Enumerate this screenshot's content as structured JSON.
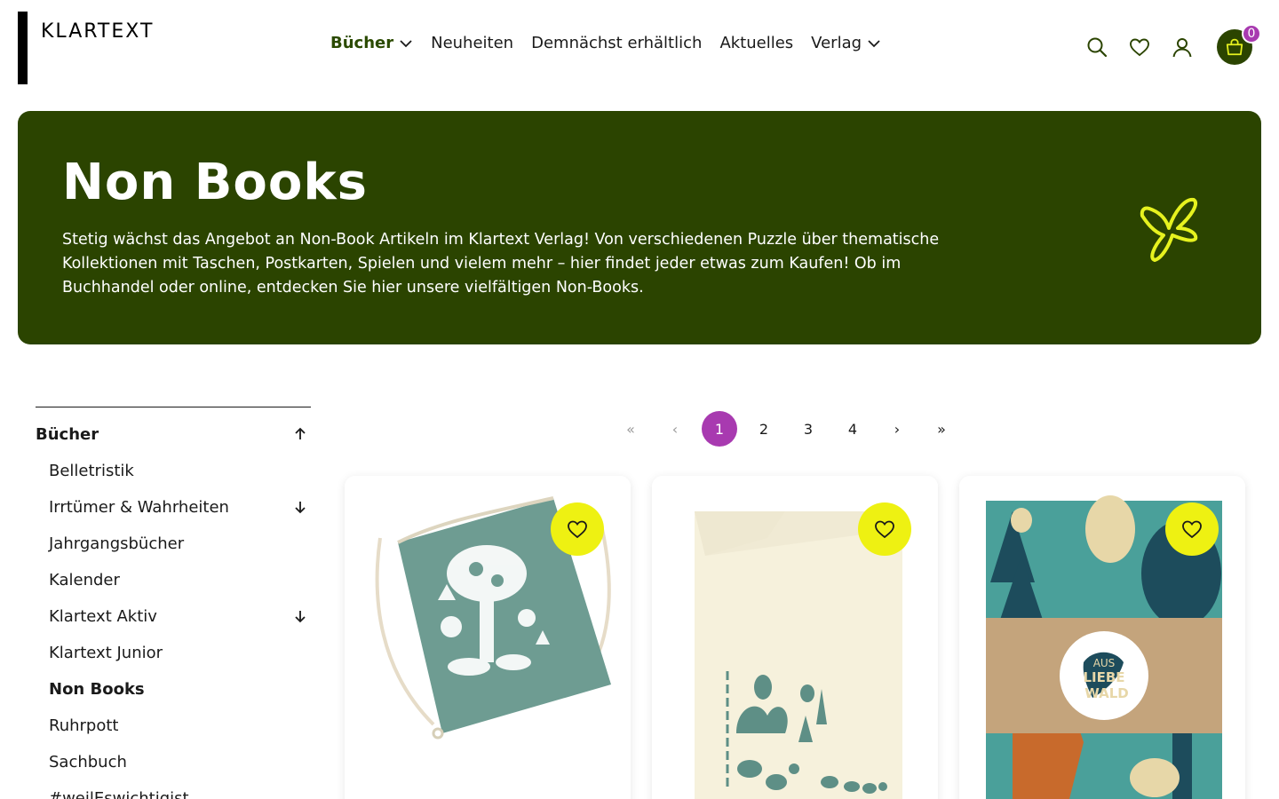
{
  "header": {
    "logo": "KLARTEXT",
    "nav": [
      {
        "label": "Bücher",
        "dropdown": true,
        "active": true
      },
      {
        "label": "Neuheiten"
      },
      {
        "label": "Demnächst erhältlich"
      },
      {
        "label": "Aktuelles"
      },
      {
        "label": "Verlag",
        "dropdown": true
      }
    ],
    "icons": [
      "search-icon",
      "heart-icon",
      "user-icon",
      "cart-icon"
    ],
    "cart_count": "0"
  },
  "hero": {
    "title": "Non Books",
    "text": "Stetig wächst das Angebot an Non-Book Artikeln im Klartext Verlag! Von verschiedenen Puzzle über thematische Kollektionen mit Taschen, Postkarten, Spielen und vielem mehr – hier findet jeder etwas zum Kaufen! Ob im Buchhandel oder online, entdecken Sie hier unsere vielfältigen Non-Books.",
    "background": "#2b4400",
    "accent": "#e6f21f"
  },
  "sidebar": {
    "heading": "Bücher",
    "items": [
      {
        "label": "Belletristik"
      },
      {
        "label": "Irrtümer & Wahrheiten",
        "expand": true
      },
      {
        "label": "Jahrgangsbücher"
      },
      {
        "label": "Kalender"
      },
      {
        "label": "Klartext Aktiv",
        "expand": true
      },
      {
        "label": "Klartext Junior"
      },
      {
        "label": "Non Books",
        "current": true
      },
      {
        "label": "Ruhrpott"
      },
      {
        "label": "Sachbuch"
      },
      {
        "label": "#weilEswichtigist"
      }
    ]
  },
  "pagination": {
    "first": "«",
    "prev": "‹",
    "pages": [
      "1",
      "2",
      "3",
      "4"
    ],
    "current": "1",
    "next": "›",
    "last": "»",
    "active_color": "#a83ab0"
  },
  "products": [
    {
      "image": "green-forest-gym-bag"
    },
    {
      "image": "aus-liebe-zum-wald-tea-towel"
    },
    {
      "image": "aus-liebe-wald-notebook"
    }
  ],
  "colors": {
    "brand_green": "#2b4400",
    "favorite_yellow": "#eef112",
    "badge_purple": "#a83ab0"
  }
}
